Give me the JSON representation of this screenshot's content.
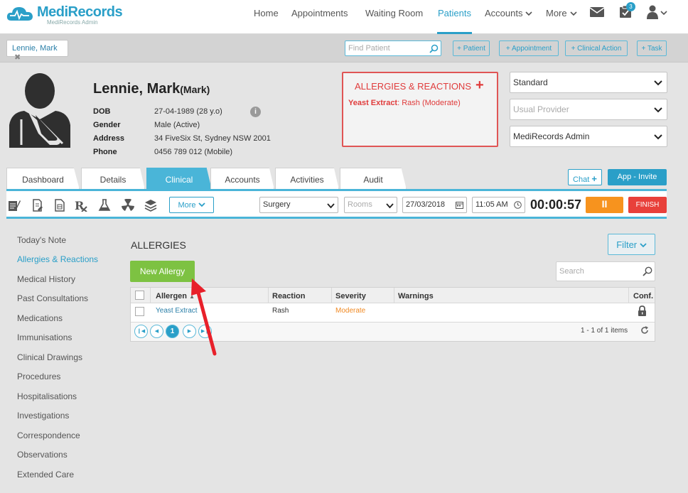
{
  "app": {
    "name": "MediRecords",
    "subtitle": "MediRecords Admin"
  },
  "nav": {
    "items": [
      {
        "label": "Home"
      },
      {
        "label": "Appointments"
      },
      {
        "label": "Waiting Room"
      },
      {
        "label": "Patients"
      },
      {
        "label": "Accounts"
      },
      {
        "label": "More"
      }
    ],
    "active": "Patients",
    "task_badge": "3"
  },
  "patient_tab": {
    "label": "Lennie, Mark",
    "close": "✖"
  },
  "find_patient": {
    "placeholder": "Find Patient"
  },
  "quick_actions": [
    "+ Patient",
    "+ Appointment",
    "+ Clinical Action",
    "+ Task"
  ],
  "patient": {
    "name": "Lennie, Mark",
    "preferred": "(Mark)",
    "fields": [
      {
        "label": "DOB",
        "value": "27-04-1989 (28 y.o)"
      },
      {
        "label": "Gender",
        "value": "Male (Active)"
      },
      {
        "label": "Address",
        "value": "34 FiveSix St, Sydney NSW 2001"
      },
      {
        "label": "Phone",
        "value": "0456 789 012 (Mobile)"
      }
    ]
  },
  "allergies_panel": {
    "title": "ALLERGIES & REACTIONS",
    "add": "+",
    "item_name": "Yeast Extract",
    "item_detail": ": Rash (Moderate)"
  },
  "header_selects": [
    {
      "value": "Standard"
    },
    {
      "placeholder": "Usual Provider"
    },
    {
      "value": "MediRecords Admin"
    }
  ],
  "tabs": [
    {
      "label": "Dashboard"
    },
    {
      "label": "Details"
    },
    {
      "label": "Clinical"
    },
    {
      "label": "Accounts"
    },
    {
      "label": "Activities"
    },
    {
      "label": "Audit"
    }
  ],
  "active_tab": "Clinical",
  "chat_label": "Chat",
  "app_invite_label": "App - Invite",
  "toolbar": {
    "more_label": "More",
    "location": "Surgery",
    "rooms_placeholder": "Rooms",
    "date": "27/03/2018",
    "time": "11:05 AM",
    "timer": "00:00:57",
    "pause_icon": "II",
    "finish": "FINISH"
  },
  "sidebar": {
    "items": [
      {
        "label": "Today's Note"
      },
      {
        "label": "Allergies & Reactions"
      },
      {
        "label": "Medical History"
      },
      {
        "label": "Past Consultations"
      },
      {
        "label": "Medications"
      },
      {
        "label": "Immunisations"
      },
      {
        "label": "Clinical Drawings"
      },
      {
        "label": "Procedures"
      },
      {
        "label": "Hospitalisations"
      },
      {
        "label": "Investigations"
      },
      {
        "label": "Correspondence"
      },
      {
        "label": "Observations"
      },
      {
        "label": "Extended Care"
      }
    ],
    "active": "Allergies & Reactions"
  },
  "allergies": {
    "title": "ALLERGIES",
    "filter_label": "Filter",
    "new_button": "New Allergy",
    "search_placeholder": "Search",
    "columns": [
      "Allergen",
      "Reaction",
      "Severity",
      "Warnings",
      "Conf."
    ],
    "sort_indicator": "▲",
    "rows": [
      {
        "allergen": "Yeast Extract",
        "reaction": "Rash",
        "severity": "Moderate",
        "warnings": ""
      }
    ],
    "pager": {
      "current_page": "1",
      "summary": "1 - 1 of 1 items"
    }
  },
  "colors": {
    "brand": "#2a9fc8",
    "tab_active": "#4ab5d8",
    "new_button": "#7dc242",
    "alert": "#e03c3c",
    "pause": "#f7931e",
    "finish": "#e8403a",
    "severity_moderate": "#f08a24",
    "arrow": "#e8202a"
  }
}
